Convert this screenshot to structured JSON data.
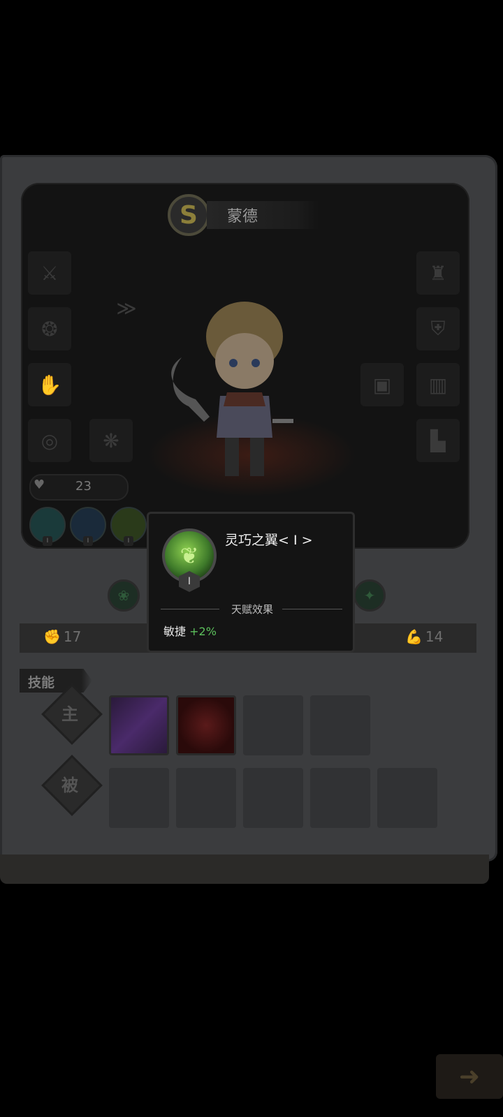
{
  "hero": {
    "grade": "S",
    "name": "蒙德",
    "power": "23"
  },
  "talents_small": [
    {
      "level": "I",
      "icon": "wind-talent-icon"
    },
    {
      "level": "I",
      "icon": "star-talent-icon"
    },
    {
      "level": "I",
      "icon": "wing-talent-icon"
    }
  ],
  "stats": {
    "strength": "17",
    "stat4": "14"
  },
  "skills": {
    "label": "技能",
    "active_row": "主",
    "passive_row": "被"
  },
  "tooltip": {
    "name": "灵巧之翼< I >",
    "level": "I",
    "section_title": "天赋效果",
    "effect_label": "敏捷",
    "effect_value": "+2%"
  },
  "colors": {
    "accent_green": "#5cc05c",
    "card_bg": "#3b3c3e"
  }
}
